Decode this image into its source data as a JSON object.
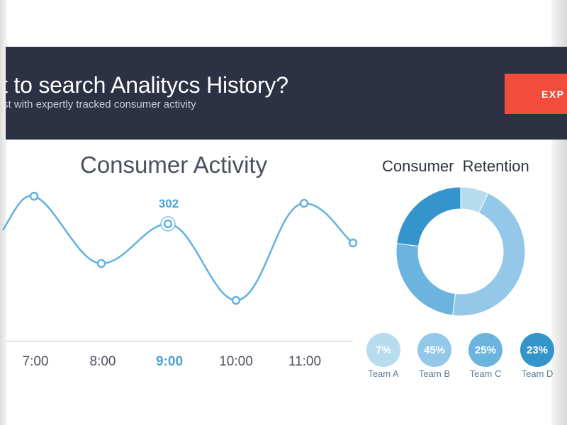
{
  "banner": {
    "title": "t to search Analitycs History?",
    "subtitle": "st with expertly tracked consumer activity",
    "button_label": "EXP"
  },
  "consumer_activity": {
    "title": "Consumer Activity",
    "peak_label": "302",
    "time_labels": [
      "7:00",
      "8:00",
      "9:00",
      "10:00",
      "11:00"
    ],
    "active_time": "9:00"
  },
  "retention": {
    "title": "Consumer Retention",
    "teams": [
      {
        "name": "Team A",
        "percent": "7%",
        "value": 7,
        "color": "#b7dcee"
      },
      {
        "name": "Team B",
        "percent": "45%",
        "value": 45,
        "color": "#93c8e8"
      },
      {
        "name": "Team C",
        "percent": "25%",
        "value": 25,
        "color": "#6ab4de"
      },
      {
        "name": "Team D",
        "percent": "23%",
        "value": 23,
        "color": "#3495cc"
      }
    ]
  },
  "colors": {
    "banner_bg": "#2c3144",
    "accent": "#4aa3d6",
    "export_button": "#f24c3d"
  }
}
